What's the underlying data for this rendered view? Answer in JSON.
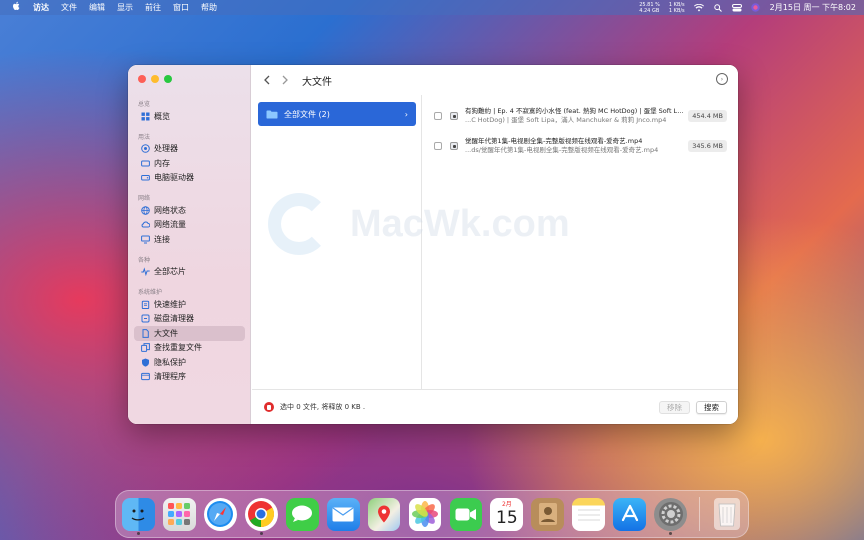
{
  "menubar": {
    "apple": "",
    "app_name": "访达",
    "menus": [
      "文件",
      "编辑",
      "显示",
      "前往",
      "窗口",
      "帮助"
    ],
    "cpu_usage": "25.81 %",
    "mem_usage": "4.24 GB",
    "net_up": "1 KB/s",
    "net_down": "1 KB/s",
    "clock": "2月15日 周一 下午8:02"
  },
  "window": {
    "title": "大文件",
    "sidebar": {
      "sections": [
        {
          "title": "总览",
          "items": [
            {
              "label": "概览",
              "icon": "grid-icon"
            }
          ]
        },
        {
          "title": "用法",
          "items": [
            {
              "label": "处理器",
              "icon": "cpu-icon"
            },
            {
              "label": "内存",
              "icon": "memory-icon"
            },
            {
              "label": "电脑驱动器",
              "icon": "drive-icon"
            }
          ]
        },
        {
          "title": "网络",
          "items": [
            {
              "label": "网络状态",
              "icon": "globe-icon"
            },
            {
              "label": "网络流量",
              "icon": "cloud-icon"
            },
            {
              "label": "连接",
              "icon": "monitor-icon"
            }
          ]
        },
        {
          "title": "各种",
          "items": [
            {
              "label": "全部芯片",
              "icon": "pulse-icon"
            }
          ]
        },
        {
          "title": "系统维护",
          "items": [
            {
              "label": "快速维护",
              "icon": "clipboard-icon"
            },
            {
              "label": "磁盘清理器",
              "icon": "broom-icon"
            },
            {
              "label": "大文件",
              "icon": "document-icon"
            },
            {
              "label": "查找重复文件",
              "icon": "duplicate-icon"
            },
            {
              "label": "隐私保护",
              "icon": "shield-icon"
            },
            {
              "label": "清理程序",
              "icon": "app-icon"
            }
          ]
        }
      ]
    },
    "folder": {
      "label": "全部文件 (2)"
    },
    "files": [
      {
        "name": "有狗難約 | Ep. 4 不寂寞的小水怪 (feat. 熱狗 MC HotDog) | 蛋堡 Soft Li...",
        "path": "...C HotDog) | 蛋堡 Soft Lipa，滿人 Manchuker & 莉莉 Jnco.mp4",
        "size": "454.4 MB"
      },
      {
        "name": "觉醒年代第1集-电视剧全集-完整版视频在线观看-爱奇艺.mp4",
        "path": "...ds/觉醒年代第1集-电视剧全集-完整版视频在线观看-爱奇艺.mp4",
        "size": "345.6 MB"
      }
    ],
    "footer": {
      "status": "选中 0 文件, 将释放 0 KB .",
      "remove_label": "移除",
      "search_label": "搜索"
    }
  },
  "watermark": "MacWk.com",
  "dock": {
    "calendar_month": "2月",
    "calendar_day": "15"
  }
}
